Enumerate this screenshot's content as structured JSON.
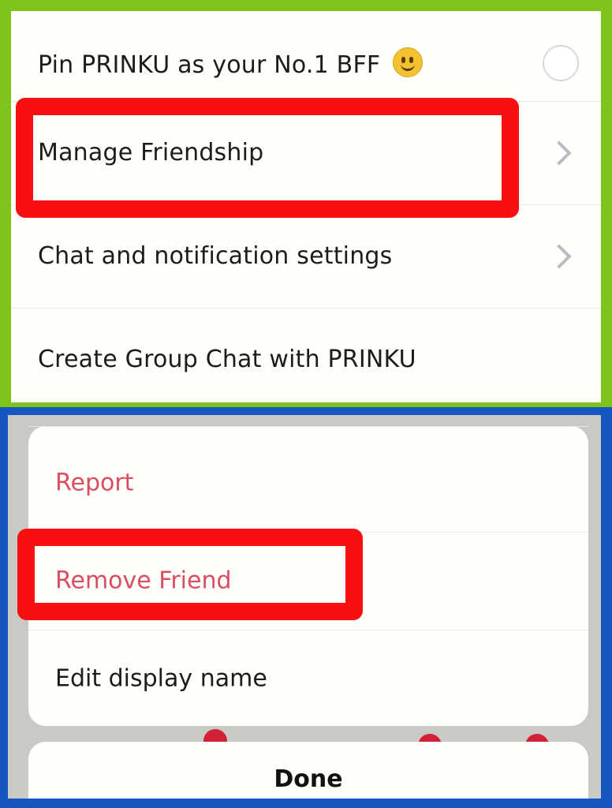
{
  "profile_menu": {
    "items": [
      {
        "label": "Pin PRINKU as your No.1 BFF",
        "control": "radio",
        "emoji": "slightly-smiling-face-icon"
      },
      {
        "label": "Manage Friendship",
        "control": "chevron"
      },
      {
        "label": "Chat and notification settings",
        "control": "chevron"
      },
      {
        "label": "Create Group Chat with PRINKU",
        "control": "none"
      }
    ]
  },
  "manage_friendship_sheet": {
    "items": [
      {
        "label": "Report",
        "style": "destructive"
      },
      {
        "label": "Remove Friend",
        "style": "destructive"
      },
      {
        "label": "Edit display name",
        "style": "default"
      }
    ],
    "done_label": "Done"
  },
  "colors": {
    "top_frame": "#7ec31a",
    "bottom_frame": "#1556c0",
    "highlight": "#f80f0f",
    "destructive_text": "#d94e61",
    "chevron": "#b9bcc2"
  }
}
